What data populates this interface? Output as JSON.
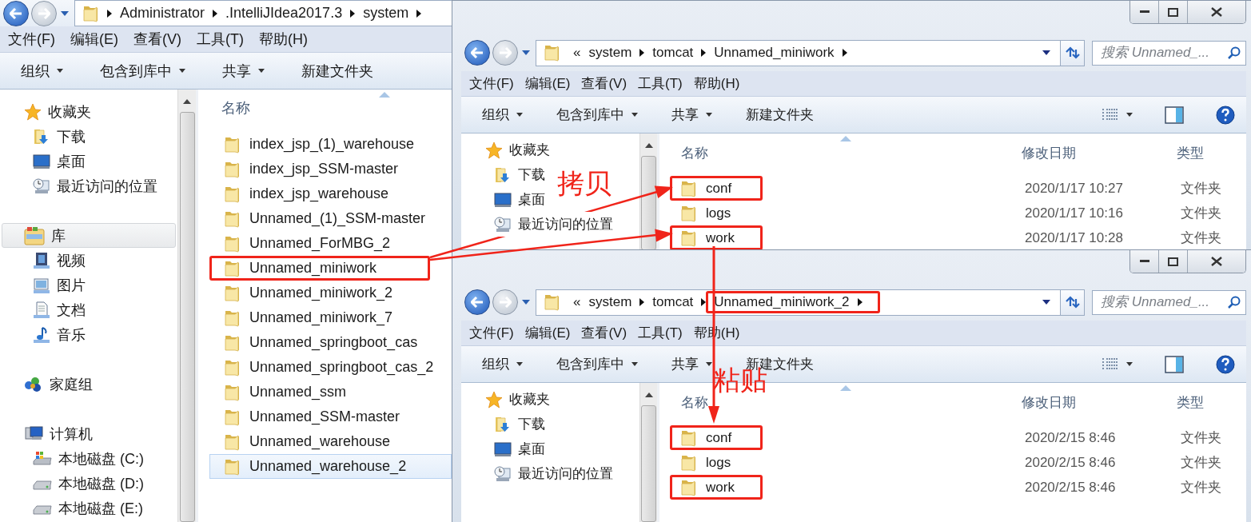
{
  "windows": [
    {
      "kind": "list",
      "caption_buttons": false,
      "address": {
        "crumbs": [
          {
            "label": "Administrator",
            "marked": false
          },
          {
            "label": ".IntelliJIdea2017.3",
            "marked": false
          },
          {
            "label": "system",
            "marked": false
          }
        ],
        "controls": false
      },
      "menu": [
        "文件(F)",
        "编辑(E)",
        "查看(V)",
        "工具(T)",
        "帮助(H)"
      ],
      "toolbar": [
        {
          "label": "组织",
          "has_menu": true
        },
        {
          "label": "包含到库中",
          "has_menu": true
        },
        {
          "label": "共享",
          "has_menu": true
        },
        {
          "label": "新建文件夹",
          "has_menu": false
        }
      ],
      "view_controls": false,
      "nav": [
        {
          "kind": "favorites",
          "label": "收藏夹",
          "selected": false,
          "children": [
            {
              "kind": "downloads",
              "label": "下载",
              "selected": false
            },
            {
              "kind": "desktop",
              "label": "桌面",
              "selected": false
            },
            {
              "kind": "recent",
              "label": "最近访问的位置",
              "selected": false
            }
          ]
        },
        {
          "kind": "library",
          "label": "库",
          "selected": true,
          "children": [
            {
              "kind": "videos",
              "label": "视频",
              "selected": false
            },
            {
              "kind": "pictures",
              "label": "图片",
              "selected": false
            },
            {
              "kind": "documents",
              "label": "文档",
              "selected": false
            },
            {
              "kind": "music",
              "label": "音乐",
              "selected": false
            }
          ]
        },
        {
          "kind": "homegroup",
          "label": "家庭组",
          "selected": false
        },
        {
          "kind": "computer",
          "label": "计算机",
          "selected": false,
          "children": [
            {
              "kind": "system-drive",
              "label": "本地磁盘 (C:)",
              "selected": false
            },
            {
              "kind": "drive",
              "label": "本地磁盘 (D:)",
              "selected": false
            },
            {
              "kind": "drive",
              "label": "本地磁盘 (E:)",
              "selected": false
            }
          ]
        }
      ],
      "columns": [
        "名称"
      ],
      "rows": [
        {
          "name": "index_jsp_(1)_warehouse",
          "selected": false,
          "marked": false
        },
        {
          "name": "index_jsp_SSM-master",
          "selected": false,
          "marked": false
        },
        {
          "name": "index_jsp_warehouse",
          "selected": false,
          "marked": false
        },
        {
          "name": "Unnamed_(1)_SSM-master",
          "selected": false,
          "marked": false
        },
        {
          "name": "Unnamed_ForMBG_2",
          "selected": false,
          "marked": false
        },
        {
          "name": "Unnamed_miniwork",
          "selected": false,
          "marked": true
        },
        {
          "name": "Unnamed_miniwork_2",
          "selected": false,
          "marked": false
        },
        {
          "name": "Unnamed_miniwork_7",
          "selected": false,
          "marked": false
        },
        {
          "name": "Unnamed_springboot_cas",
          "selected": false,
          "marked": false
        },
        {
          "name": "Unnamed_springboot_cas_2",
          "selected": false,
          "marked": false
        },
        {
          "name": "Unnamed_ssm",
          "selected": false,
          "marked": false
        },
        {
          "name": "Unnamed_SSM-master",
          "selected": false,
          "marked": false
        },
        {
          "name": "Unnamed_warehouse",
          "selected": false,
          "marked": false
        },
        {
          "name": "Unnamed_warehouse_2",
          "selected": true,
          "marked": false
        }
      ]
    },
    {
      "kind": "details",
      "caption_buttons": true,
      "address": {
        "overflow": "«",
        "crumbs": [
          {
            "label": "system",
            "marked": false
          },
          {
            "label": "tomcat",
            "marked": false
          },
          {
            "label": "Unnamed_miniwork",
            "marked": false
          }
        ],
        "controls": true
      },
      "search": {
        "placeholder": "搜索 Unnamed_..."
      },
      "menu": [
        "文件(F)",
        "编辑(E)",
        "查看(V)",
        "工具(T)",
        "帮助(H)"
      ],
      "toolbar": [
        {
          "label": "组织",
          "has_menu": true
        },
        {
          "label": "包含到库中",
          "has_menu": true
        },
        {
          "label": "共享",
          "has_menu": true
        },
        {
          "label": "新建文件夹",
          "has_menu": false
        }
      ],
      "view_controls": true,
      "nav": [
        {
          "kind": "favorites",
          "label": "收藏夹",
          "selected": false,
          "children": [
            {
              "kind": "downloads",
              "label": "下载",
              "selected": false
            },
            {
              "kind": "desktop",
              "label": "桌面",
              "selected": false
            },
            {
              "kind": "recent",
              "label": "最近访问的位置",
              "selected": false
            }
          ]
        }
      ],
      "columns": [
        "名称",
        "修改日期",
        "类型"
      ],
      "rows": [
        {
          "name": "conf",
          "modified": "2020/1/17 10:27",
          "type": "文件夹",
          "selected": false,
          "marked": true
        },
        {
          "name": "logs",
          "modified": "2020/1/17 10:16",
          "type": "文件夹",
          "selected": false,
          "marked": false
        },
        {
          "name": "work",
          "modified": "2020/1/17 10:28",
          "type": "文件夹",
          "selected": false,
          "marked": true
        }
      ]
    },
    {
      "kind": "details",
      "caption_buttons": true,
      "address": {
        "overflow": "«",
        "crumbs": [
          {
            "label": "system",
            "marked": false
          },
          {
            "label": "tomcat",
            "marked": false
          },
          {
            "label": "Unnamed_miniwork_2",
            "marked": true
          }
        ],
        "controls": true
      },
      "search": {
        "placeholder": "搜索 Unnamed_..."
      },
      "menu": [
        "文件(F)",
        "编辑(E)",
        "查看(V)",
        "工具(T)",
        "帮助(H)"
      ],
      "toolbar": [
        {
          "label": "组织",
          "has_menu": true
        },
        {
          "label": "包含到库中",
          "has_menu": true
        },
        {
          "label": "共享",
          "has_menu": true
        },
        {
          "label": "新建文件夹",
          "has_menu": false
        }
      ],
      "view_controls": true,
      "nav": [
        {
          "kind": "favorites",
          "label": "收藏夹",
          "selected": false,
          "children": [
            {
              "kind": "downloads",
              "label": "下载",
              "selected": false
            },
            {
              "kind": "desktop",
              "label": "桌面",
              "selected": false
            },
            {
              "kind": "recent",
              "label": "最近访问的位置",
              "selected": false
            }
          ]
        }
      ],
      "columns": [
        "名称",
        "修改日期",
        "类型"
      ],
      "rows": [
        {
          "name": "conf",
          "modified": "2020/2/15 8:46",
          "type": "文件夹",
          "selected": false,
          "marked": true
        },
        {
          "name": "logs",
          "modified": "2020/2/15 8:46",
          "type": "文件夹",
          "selected": false,
          "marked": false
        },
        {
          "name": "work",
          "modified": "2020/2/15 8:46",
          "type": "文件夹",
          "selected": false,
          "marked": true
        }
      ]
    }
  ],
  "annotations": {
    "copy_label": "拷贝",
    "paste_label": "粘贴"
  }
}
